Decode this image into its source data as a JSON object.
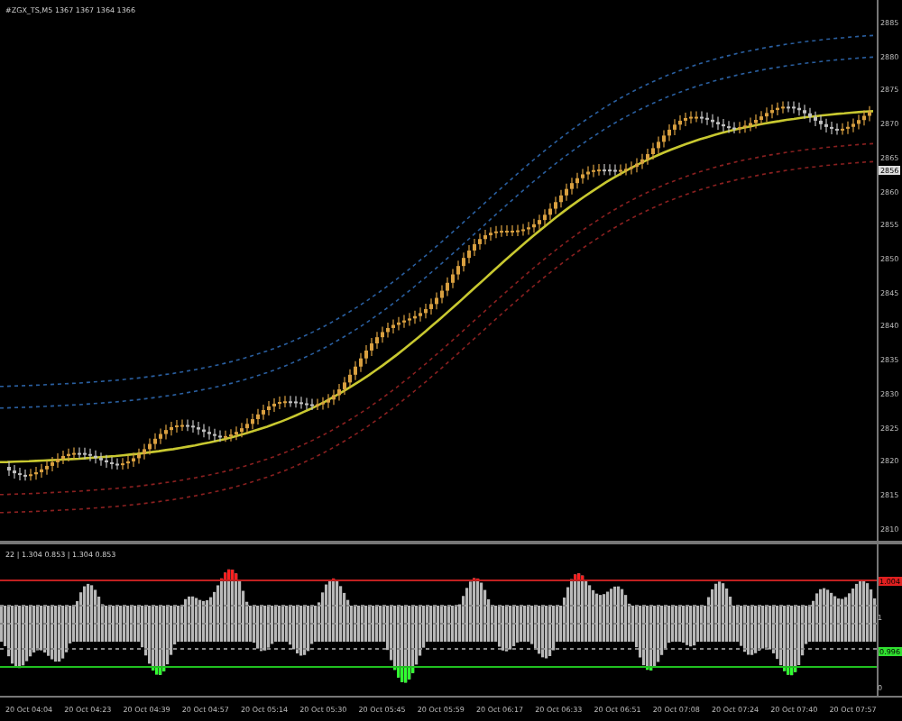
{
  "chart": {
    "title": "#ZGX_TS,M5 1367 1367 1364 1366",
    "price_labels": [
      "2885",
      "2880",
      "2875",
      "2870",
      "2865",
      "2860",
      "2855",
      "2850",
      "2845",
      "2840",
      "2835",
      "2830",
      "2825",
      "2820",
      "2815",
      "2810"
    ],
    "current_price": "2856"
  },
  "indicator": {
    "title": "22 | 1.304 0.853 | 1.304 0.853",
    "upper_level": "1.004",
    "middle_label": "1",
    "lower_level": "0.996",
    "bottom_label": "0"
  },
  "time_labels": [
    "20 Oct 04:04",
    "20 Oct 04:23",
    "20 Oct 04:39",
    "20 Oct 04:57",
    "20 Oct 05:14",
    "20 Oct 05:30",
    "20 Oct 05:45",
    "20 Oct 05:59",
    "20 Oct 06:17",
    "20 Oct 06:33",
    "20 Oct 06:51",
    "20 Oct 07:08",
    "20 Oct 07:24",
    "20 Oct 07:40",
    "20 Oct 07:57"
  ]
}
